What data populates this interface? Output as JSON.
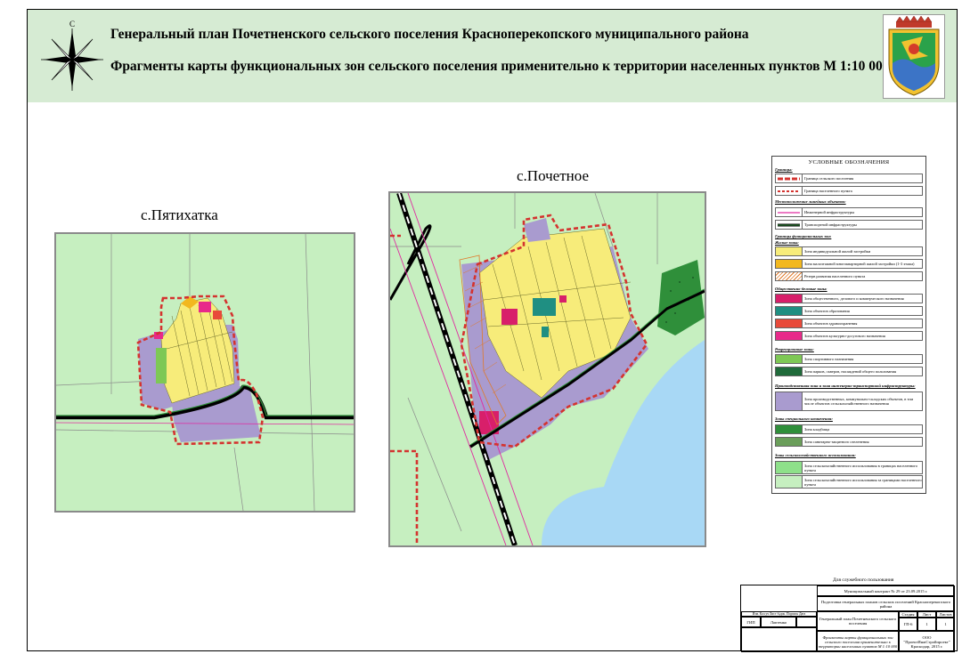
{
  "header": {
    "title_line1": "Генеральный план Почетненского сельского поселения Красноперекопского муниципального района",
    "title_line2": "Фрагменты карты функциональных зон сельского поселения применительно к территории населенных пунктов М 1:10 000",
    "compass_letter": "С"
  },
  "maps": {
    "left_label": "с.Пятихатка",
    "right_label": "с.Почетное"
  },
  "colors": {
    "agri": "#c6efc0",
    "residential": "#f7ec7a",
    "industrial": "#a99bcf",
    "water": "#a8d8f5",
    "forest_green": "#2f8f3a",
    "border_red": "#d4332f"
  },
  "legend": {
    "title": "УСЛОВНЫЕ ОБОЗНАЧЕНИЯ",
    "sections": {
      "borders": "Границы:",
      "infra": "Местоположение линейных объектов:",
      "zones": "Границы функциональных зон:",
      "residential": "Жилые зоны:",
      "public": "Общественно-деловые зоны:",
      "recreation": "Рекреационные зоны:",
      "industrial": "Производственная зона и зона инженерно-транспортной инфраструктуры:",
      "special": "Зоны специального назначения:",
      "agri": "Зоны сельскохозяйственного использования:"
    },
    "items": {
      "b1": "Граница сельского поселения",
      "b2": "Граница населенного пункта",
      "i1": "Инженерной инфраструктуры",
      "i2": "Транспортной инфраструктуры",
      "r1": "Зона индивидуальной жилой застройки",
      "r2": "Зона малоэтажной многоквартирной жилой застройки (1-3 этажа)",
      "r3": "Резерв развития населенного пункта",
      "p1": "Зона общественного, делового и коммерческого назначения",
      "p2": "Зона объектов образования",
      "p3": "Зона объектов здравоохранения",
      "p4": "Зона объектов культурно-досугового назначения",
      "c1": "Зона спортивного назначения",
      "c2": "Зона парков, скверов, насаждений общего пользования",
      "n1": "Зона производственных, коммунально-складских объектов, в том числе объектов сельскохозяйственного назначения",
      "s1": "Зона кладбища",
      "s2": "Зона санитарно-защитного озеленения",
      "a1": "Зона сельскохозяйственного использования в границах населенного пункта",
      "a2": "Зона сельскохозяйственного использования за границами населенного пункта"
    }
  },
  "stamp": {
    "service_label": "Для служебного пользования",
    "contract": "Муниципальный контракт № 29 от 23.09.2015 г.",
    "project": "Подготовка генеральных планов сельских поселений Красноперекопского района",
    "object": "Генеральный план Почетненского сельского поселения",
    "sheet_desc": "Фрагменты карты функциональных зон сельского поселения применительно к территории населенных пунктов М 1:10 000",
    "company": "ООО \"ПроектИнжСтройпроект\" Краснодар, 2015 г.",
    "col_stage": "Стадия",
    "col_sheet": "Лист",
    "col_sheets": "Листов",
    "stage": "ГП-6",
    "sheet": "1",
    "sheets": "1",
    "gip_label": "ГИП",
    "gip_name": "Лаптенко",
    "header_cells": "Изм. Кол.уч Лист №док. Подпись Дата"
  }
}
